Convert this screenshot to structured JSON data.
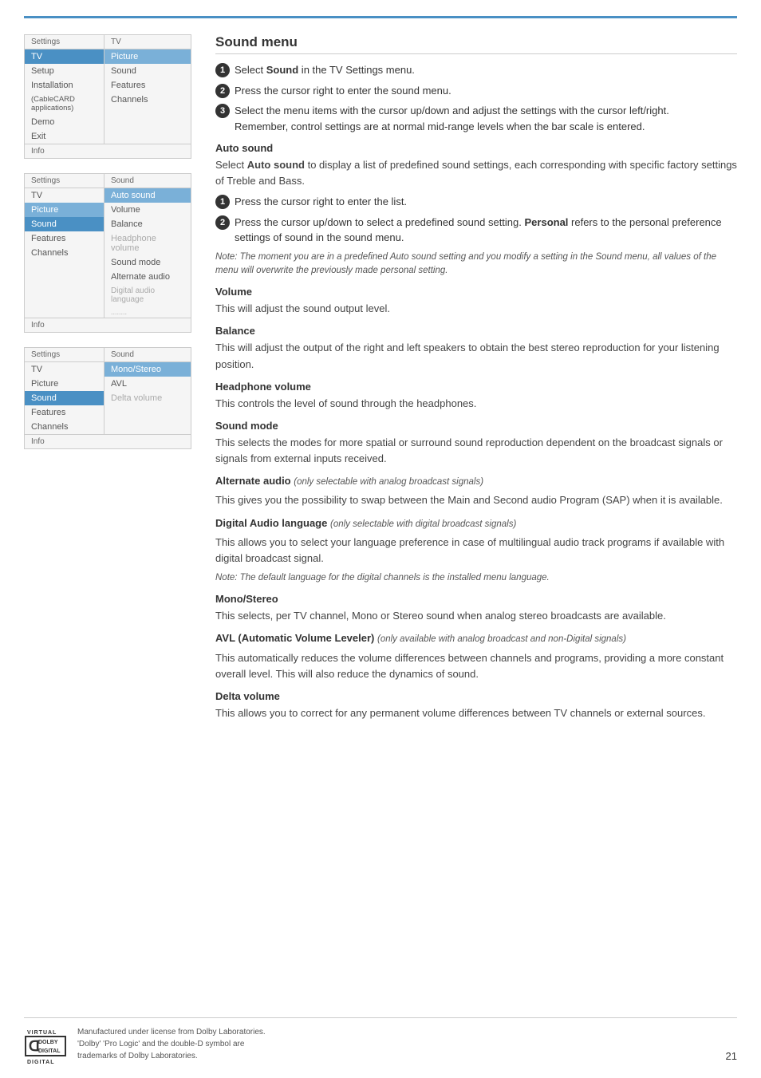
{
  "page": {
    "top_line_color": "#4a90c4",
    "page_number": "21"
  },
  "menu1": {
    "label_left": "Settings",
    "label_right": "TV",
    "left_items": [
      {
        "label": "TV",
        "state": "selected"
      },
      {
        "label": "Setup",
        "state": "normal"
      },
      {
        "label": "Installation",
        "state": "normal"
      },
      {
        "label": "(CableCARD applications)",
        "state": "normal"
      },
      {
        "label": "Demo",
        "state": "normal"
      },
      {
        "label": "Exit",
        "state": "normal"
      }
    ],
    "right_items": [
      {
        "label": "Picture",
        "state": "highlighted"
      },
      {
        "label": "Sound",
        "state": "normal"
      },
      {
        "label": "Features",
        "state": "normal"
      },
      {
        "label": "Channels",
        "state": "normal"
      }
    ],
    "info": "Info"
  },
  "menu2": {
    "label_left": "Settings",
    "label_right": "Sound",
    "left_items": [
      {
        "label": "TV",
        "state": "normal"
      },
      {
        "label": "Picture",
        "state": "highlighted"
      },
      {
        "label": "Sound",
        "state": "selected"
      },
      {
        "label": "Features",
        "state": "normal"
      },
      {
        "label": "Channels",
        "state": "normal"
      }
    ],
    "right_items": [
      {
        "label": "Auto sound",
        "state": "highlighted"
      },
      {
        "label": "Volume",
        "state": "normal"
      },
      {
        "label": "Balance",
        "state": "normal"
      },
      {
        "label": "Headphone volume",
        "state": "dimmed"
      },
      {
        "label": "Sound mode",
        "state": "normal"
      },
      {
        "label": "Alternate audio",
        "state": "normal"
      },
      {
        "label": "Digital audio language",
        "state": "dimmed"
      }
    ],
    "dots": "........",
    "info": "Info"
  },
  "menu3": {
    "label_left": "Settings",
    "label_right": "Sound",
    "left_items": [
      {
        "label": "TV",
        "state": "normal"
      },
      {
        "label": "Picture",
        "state": "normal"
      },
      {
        "label": "Sound",
        "state": "selected"
      },
      {
        "label": "Features",
        "state": "normal"
      },
      {
        "label": "Channels",
        "state": "normal"
      }
    ],
    "right_items": [
      {
        "label": "Mono/Stereo",
        "state": "highlighted"
      },
      {
        "label": "AVL",
        "state": "normal"
      },
      {
        "label": "Delta volume",
        "state": "dimmed"
      }
    ],
    "info": "Info"
  },
  "content": {
    "sound_menu_title": "Sound menu",
    "sound_menu_steps": [
      {
        "num": "1",
        "text": "Select ",
        "bold": "Sound",
        "rest": " in the TV Settings menu."
      },
      {
        "num": "2",
        "text": "Press the cursor right to enter the sound menu."
      },
      {
        "num": "3",
        "text": "Select the menu items with the cursor up/down and adjust the settings with the cursor left/right.\nRemember, control settings are at normal mid-range levels when the bar scale is entered."
      }
    ],
    "auto_sound_title": "Auto sound",
    "auto_sound_body": "Select Auto sound to display a list of predefined sound settings, each corresponding with specific factory settings of Treble and Bass.",
    "auto_sound_steps": [
      {
        "num": "1",
        "text": "Press the cursor right to enter the list."
      },
      {
        "num": "2",
        "text": "Press the cursor up/down to select a predefined sound setting. Personal refers to the personal preference settings of sound in the sound menu."
      }
    ],
    "auto_sound_note": "Note: The moment you are in a predefined Auto sound setting and you modify a setting in the Sound menu, all values of the menu will overwrite the previously made personal setting.",
    "volume_title": "Volume",
    "volume_body": "This will adjust the sound output level.",
    "balance_title": "Balance",
    "balance_body": "This will adjust the output of the right and left speakers to obtain the best stereo reproduction for your listening position.",
    "headphone_title": "Headphone volume",
    "headphone_body": "This controls the level of sound through the headphones.",
    "sound_mode_title": "Sound mode",
    "sound_mode_body": "This selects the modes for more spatial or surround sound reproduction dependent on the broadcast signals or signals from external inputs received.",
    "alternate_audio_title": "Alternate audio",
    "alternate_audio_subtitle": "(only selectable with analog broadcast signals)",
    "alternate_audio_body": "This gives you the possibility to swap between the Main and Second audio Program (SAP) when it is available.",
    "digital_audio_title": "Digital Audio language",
    "digital_audio_subtitle": "(only selectable with digital broadcast signals)",
    "digital_audio_body": "This allows you to select your language preference in case of multilingual audio track programs if available with digital broadcast signal.",
    "digital_audio_note": "Note: The default language for the digital channels is the installed menu language.",
    "mono_stereo_title": "Mono/Stereo",
    "mono_stereo_body": "This selects, per TV channel, Mono or Stereo sound when analog stereo broadcasts are available.",
    "avl_title": "AVL (Automatic Volume Leveler)",
    "avl_subtitle": "(only available with analog broadcast and non-Digital signals)",
    "avl_body": "This automatically reduces the volume differences between channels and programs, providing a more constant overall level. This will also reduce the dynamics of sound.",
    "delta_title": "Delta volume",
    "delta_body": "This allows you to correct for any permanent volume differences between TV channels or external sources."
  },
  "footer": {
    "text_line1": "Manufactured under license from Dolby Laboratories.",
    "text_line2": "'Dolby' 'Pro Logic' and the double-D symbol are",
    "text_line3": "trademarks of Dolby Laboratories."
  }
}
